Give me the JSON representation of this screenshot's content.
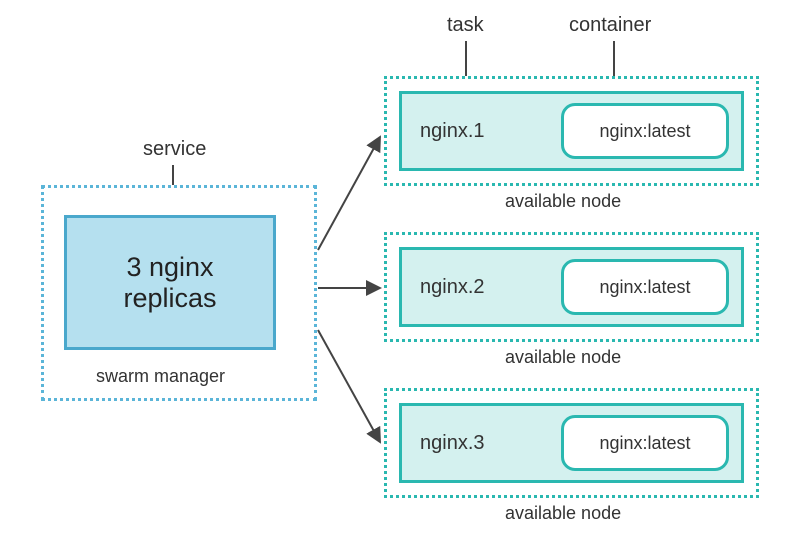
{
  "labels": {
    "service": "service",
    "task": "task",
    "container": "container",
    "swarm_manager": "swarm manager",
    "available_node": "available node"
  },
  "service": {
    "text": "3 nginx\nreplicas"
  },
  "nodes": [
    {
      "task": "nginx.1",
      "container": "nginx:latest"
    },
    {
      "task": "nginx.2",
      "container": "nginx:latest"
    },
    {
      "task": "nginx.3",
      "container": "nginx:latest"
    }
  ],
  "colors": {
    "service_border": "#4aa8cc",
    "service_fill": "#b5e0ef",
    "manager_dotted": "#5bb5d8",
    "node_teal": "#2ab8b0",
    "node_fill": "#d4f1ef"
  }
}
